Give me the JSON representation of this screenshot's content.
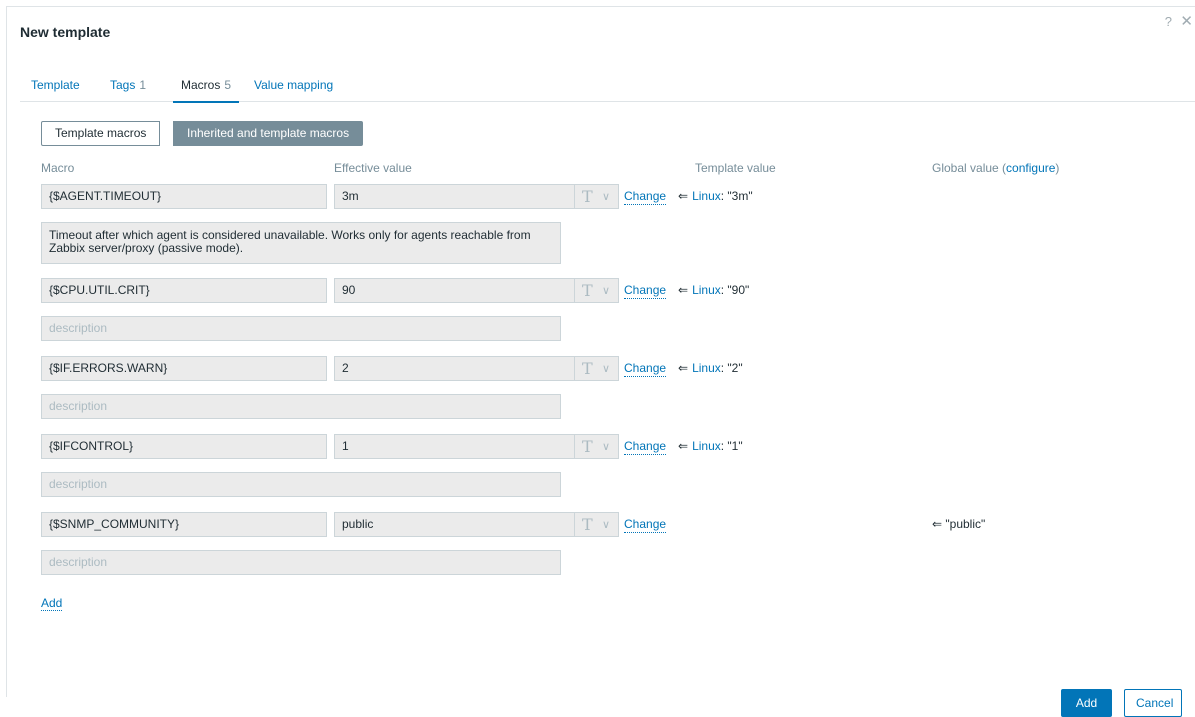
{
  "dialog": {
    "title": "New template",
    "help_icon": "?",
    "close_icon": "✕"
  },
  "tabs": [
    {
      "label": "Template",
      "count": ""
    },
    {
      "label": "Tags",
      "count": "1"
    },
    {
      "label": "Macros",
      "count": "5"
    },
    {
      "label": "Value mapping",
      "count": ""
    }
  ],
  "active_tab": "Macros",
  "segments": {
    "template_macros": "Template macros",
    "inherited": "Inherited and template macros"
  },
  "columns": {
    "macro": "Macro",
    "effective_value": "Effective value",
    "template_value": "Template value",
    "global_value": "Global value (",
    "global_link": "configure",
    "global_close": ")"
  },
  "macros": [
    {
      "name": "{$AGENT.TIMEOUT}",
      "value": "3m",
      "description": "Timeout after which agent is considered unavailable. Works only for agents reachable from Zabbix server/proxy (passive mode).",
      "change": "Change",
      "arrow": "⇐",
      "template_link": "Linux",
      "template_value": ": \"3m\"",
      "global_value": ""
    },
    {
      "name": "{$CPU.UTIL.CRIT}",
      "value": "90",
      "description": "",
      "change": "Change",
      "arrow": "⇐",
      "template_link": "Linux",
      "template_value": ": \"90\"",
      "global_value": ""
    },
    {
      "name": "{$IF.ERRORS.WARN}",
      "value": "2",
      "description": "",
      "change": "Change",
      "arrow": "⇐",
      "template_link": "Linux",
      "template_value": ": \"2\"",
      "global_value": ""
    },
    {
      "name": "{$IFCONTROL}",
      "value": "1",
      "description": "",
      "change": "Change",
      "arrow": "⇐",
      "template_link": "Linux",
      "template_value": ": \"1\"",
      "global_value": ""
    },
    {
      "name": "{$SNMP_COMMUNITY}",
      "value": "public",
      "description": "",
      "change": "Change",
      "arrow": "",
      "template_link": "",
      "template_value": "",
      "global_value": "⇐ \"public\""
    }
  ],
  "description_placeholder": "description",
  "value_type_icon": "T",
  "value_type_chevron": "∨",
  "add_link": "Add",
  "footer": {
    "add": "Add",
    "cancel": "Cancel"
  },
  "colors": {
    "link": "#0275b8",
    "muted": "#768d99",
    "field_bg": "#ebebeb"
  }
}
